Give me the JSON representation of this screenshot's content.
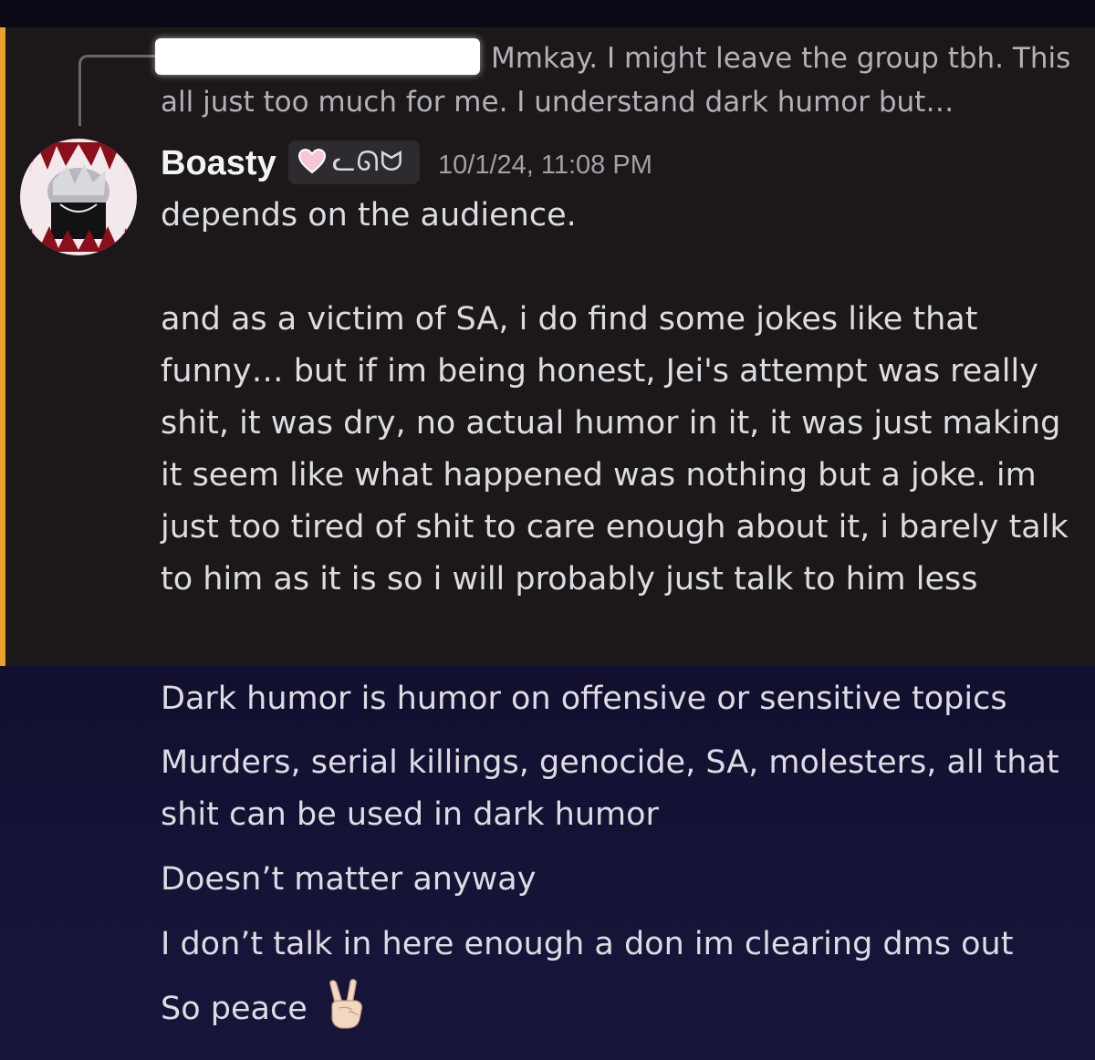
{
  "reply": {
    "preview_text": "Mmkay. I might leave the group tbh. This all just too much for me.   I understand dark humor but…"
  },
  "message": {
    "author": "Boasty",
    "tag": "ᓚᘏᗢ",
    "tag_icon": "pink-heart-icon",
    "timestamp": "10/1/24, 11:08 PM",
    "line1": "depends on the audience.",
    "line2": "and as a victim of SA, i do find some jokes like that funny… but if im being honest, Jei's attempt was really shit, it was dry, no actual humor in it, it was just making it seem like what happened was nothing but a joke. im just too tired of shit to care enough about it, i barely talk to him as it is so i will probably just talk to him less"
  },
  "followups": [
    "Dark humor is humor on offensive or sensitive topics",
    "Murders, serial killings, genocide, SA, molesters, all that shit can be used in dark humor",
    "Doesn’t matter anyway",
    "I don’t talk in here enough a don im clearing dms out",
    "So peace"
  ],
  "colors": {
    "mention_bar": "#eaa22a",
    "highlight_bg": "#1c1718",
    "username": "#f2f3f5",
    "timestamp": "#a1a0a8"
  }
}
